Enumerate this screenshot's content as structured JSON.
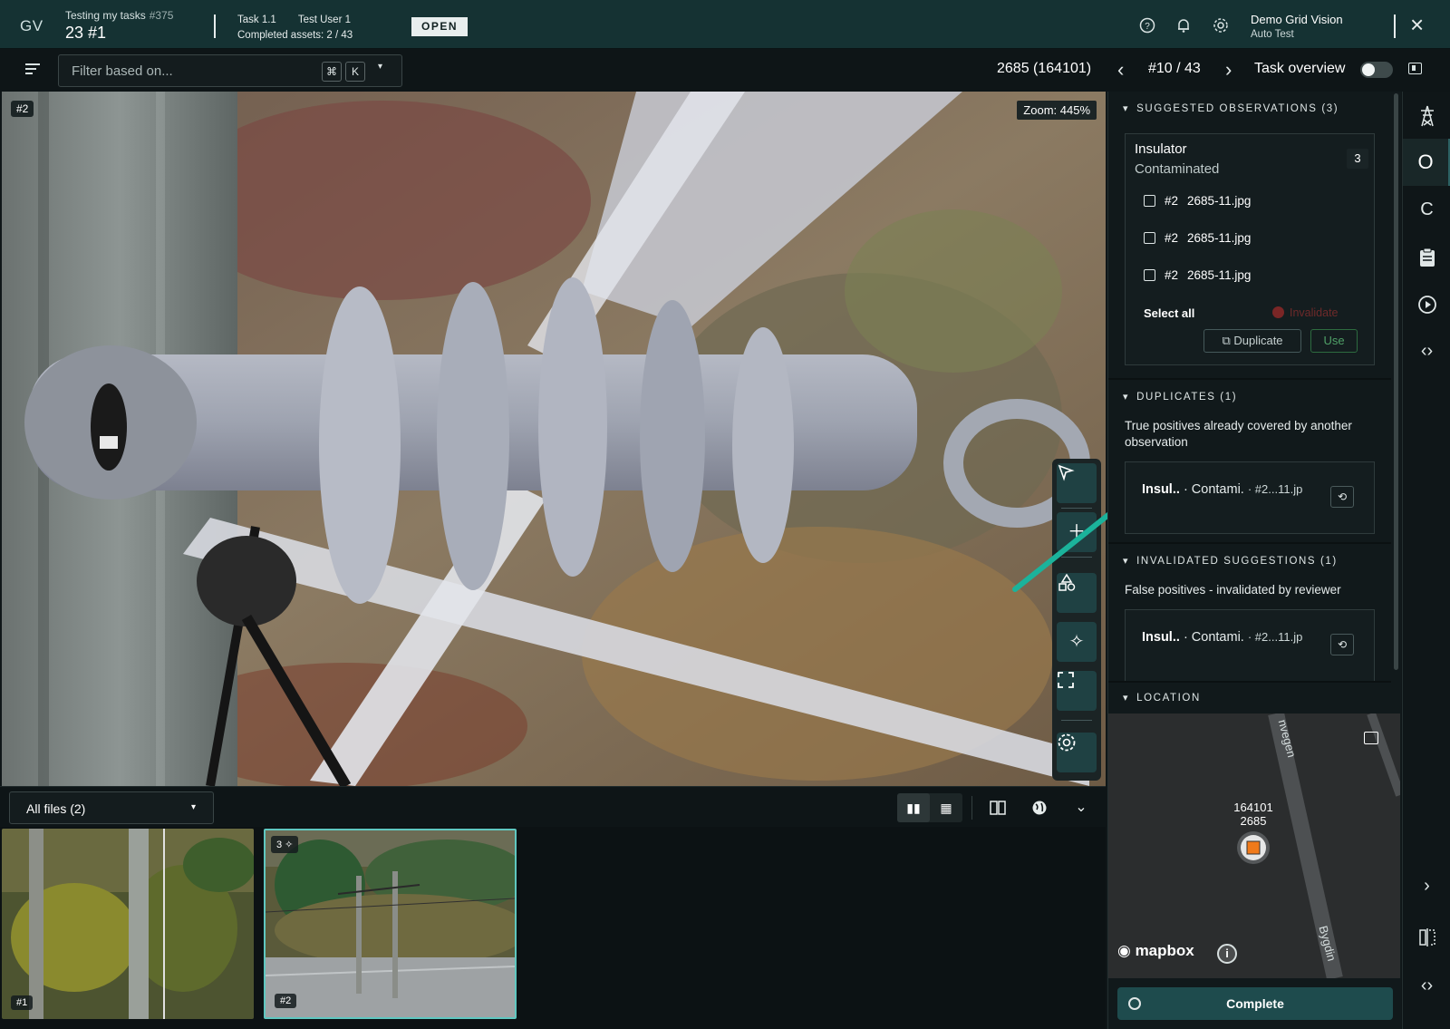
{
  "header": {
    "logo": "GV",
    "task_name": "Testing my tasks",
    "task_number": "#375",
    "asset_line": "23  #1",
    "task_id": "Task 1.1",
    "assignee": "Test User 1",
    "completed_assets": "Completed assets: 2 / 43",
    "status": "OPEN",
    "org_name": "Demo Grid Vision",
    "org_sub": "Auto Test",
    "icons": [
      "help-icon",
      "bell-icon",
      "gear-icon",
      "close-icon"
    ]
  },
  "toolbar": {
    "filter_placeholder": "Filter based on...",
    "shortcut_mod": "⌘",
    "shortcut_key": "K",
    "asset_id": "2685 (164101)",
    "position": "#10 / 43",
    "overview_label": "Task overview"
  },
  "viewer": {
    "image_tag": "#2",
    "zoom": "Zoom: 445%",
    "tools": [
      "cursor-icon",
      "plus-icon",
      "shapes-icon",
      "sparkle-icon",
      "fullscreen-icon",
      "gear-icon"
    ]
  },
  "filmstrip": {
    "files_label": "All files (2)",
    "thumbs": [
      {
        "tag": "#1"
      },
      {
        "tag": "#2",
        "badge": "3 ✧"
      }
    ]
  },
  "panel": {
    "suggested": {
      "header": "SUGGESTED OBSERVATIONS (3)",
      "card_title": "Insulator",
      "card_subtitle": "Contaminated",
      "count": "3",
      "rows": [
        {
          "num": "#2",
          "file": "2685-11.jpg"
        },
        {
          "num": "#2",
          "file": "2685-11.jpg"
        },
        {
          "num": "#2",
          "file": "2685-11.jpg"
        }
      ],
      "select_all": "Select all",
      "invalidate": "Invalidate",
      "duplicate": "Duplicate",
      "use": "Use"
    },
    "duplicates": {
      "header": "DUPLICATES (1)",
      "description": "True positives already covered by another observation",
      "item_a": "Insul..",
      "item_b": "· Contami.",
      "item_c": "· #2...11.jp"
    },
    "invalidated": {
      "header": "INVALIDATED SUGGESTIONS (1)",
      "description": "False positives - invalidated by reviewer",
      "item_a": "Insul..",
      "item_b": "· Contami.",
      "item_c": "· #2...11.jp"
    },
    "location": {
      "header": "LOCATION",
      "pin_line1": "164101",
      "pin_line2": "2685",
      "road_1": "nvegen",
      "road_2": "Bygdin",
      "attribution": "mapbox",
      "info": "i"
    },
    "complete_label": "Complete"
  },
  "rnav": {
    "items": [
      "tower-icon",
      "O",
      "C",
      "clipboard-icon",
      "history-icon",
      "code-icon"
    ],
    "bottom": [
      "chevron-right-icon",
      "split-icon",
      "code-icon"
    ]
  }
}
